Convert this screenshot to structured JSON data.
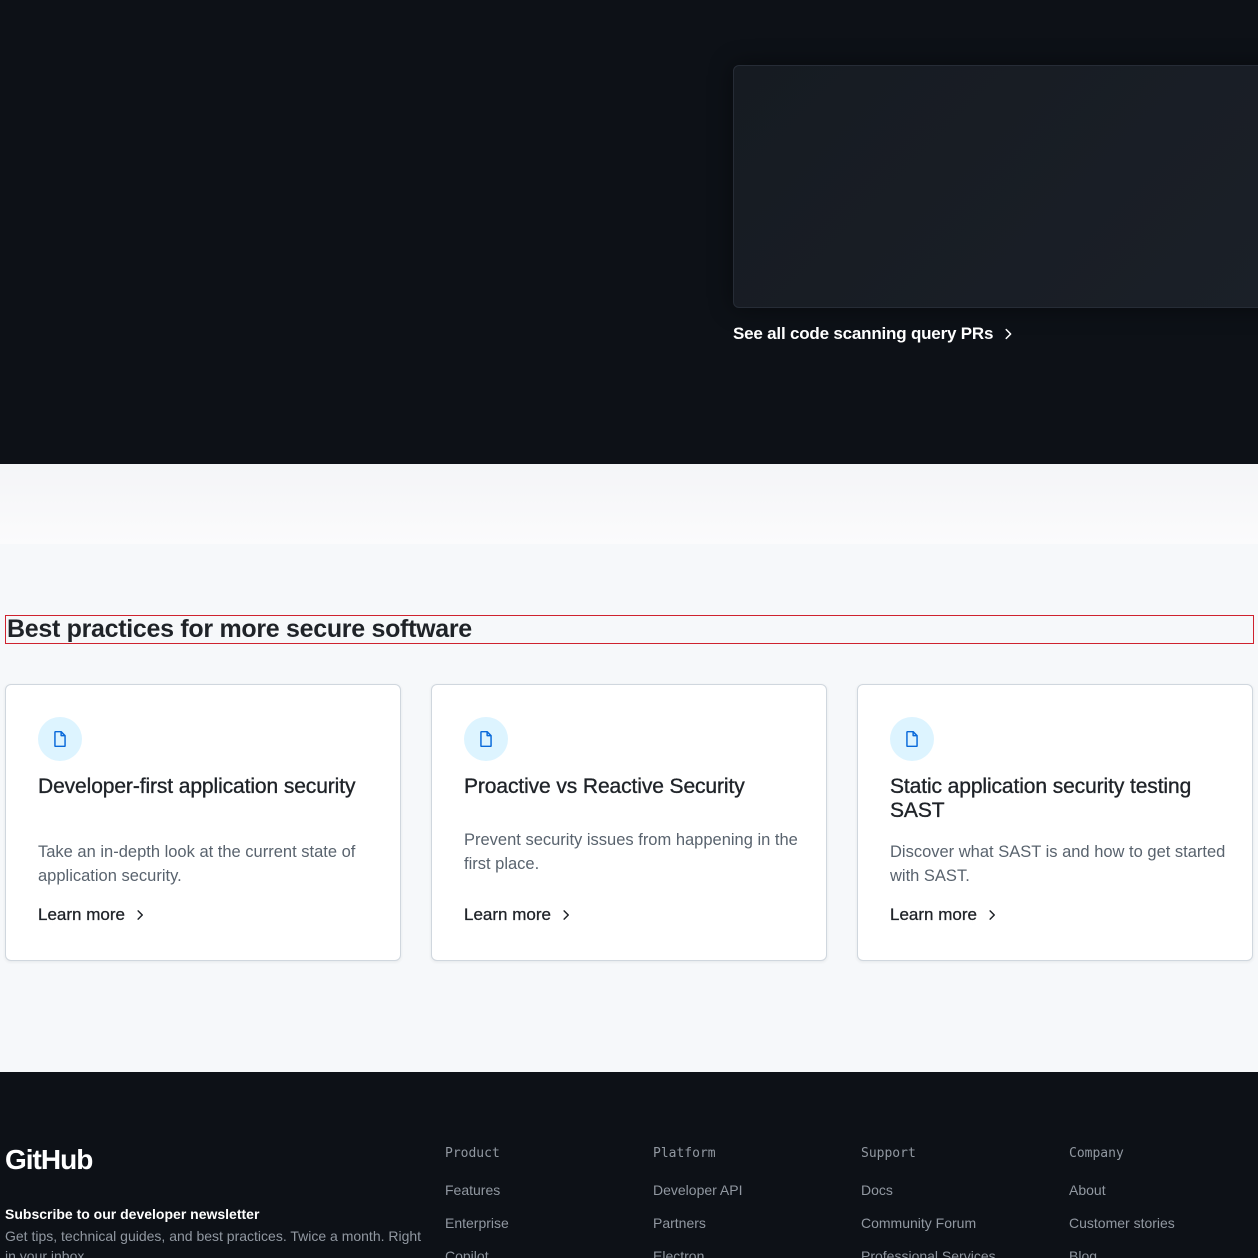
{
  "hero": {
    "link_label": "See all code scanning query PRs"
  },
  "best_practices": {
    "title": "Best practices for more secure software",
    "cards": [
      {
        "title": "Developer-first application security",
        "description": "Take an in-depth look at the current state of application security.",
        "link": "Learn more"
      },
      {
        "title": "Proactive vs Reactive Security",
        "description": "Prevent security issues from happening in the first place.",
        "link": "Learn more"
      },
      {
        "title": "Static application security testing SAST",
        "description": "Discover what SAST is and how to get started with SAST.",
        "link": "Learn more"
      }
    ]
  },
  "footer": {
    "logo": "GitHub",
    "newsletter_title": "Subscribe to our developer newsletter",
    "newsletter_desc": "Get tips, technical guides, and best practices. Twice a month. Right in your inbox.",
    "columns": [
      {
        "heading": "Product",
        "links": [
          "Features",
          "Enterprise",
          "Copilot"
        ]
      },
      {
        "heading": "Platform",
        "links": [
          "Developer API",
          "Partners",
          "Electron"
        ]
      },
      {
        "heading": "Support",
        "links": [
          "Docs",
          "Community Forum",
          "Professional Services"
        ]
      },
      {
        "heading": "Company",
        "links": [
          "About",
          "Customer stories",
          "Blog"
        ]
      }
    ]
  },
  "colors": {
    "dark_bg": "#0d1117",
    "light_bg": "#f6f8fa",
    "icon_blue": "#0969da",
    "icon_badge_bg": "#ddf4ff"
  },
  "icons": {
    "card_icon": "file-icon",
    "link_icon": "chevron-right-icon"
  }
}
